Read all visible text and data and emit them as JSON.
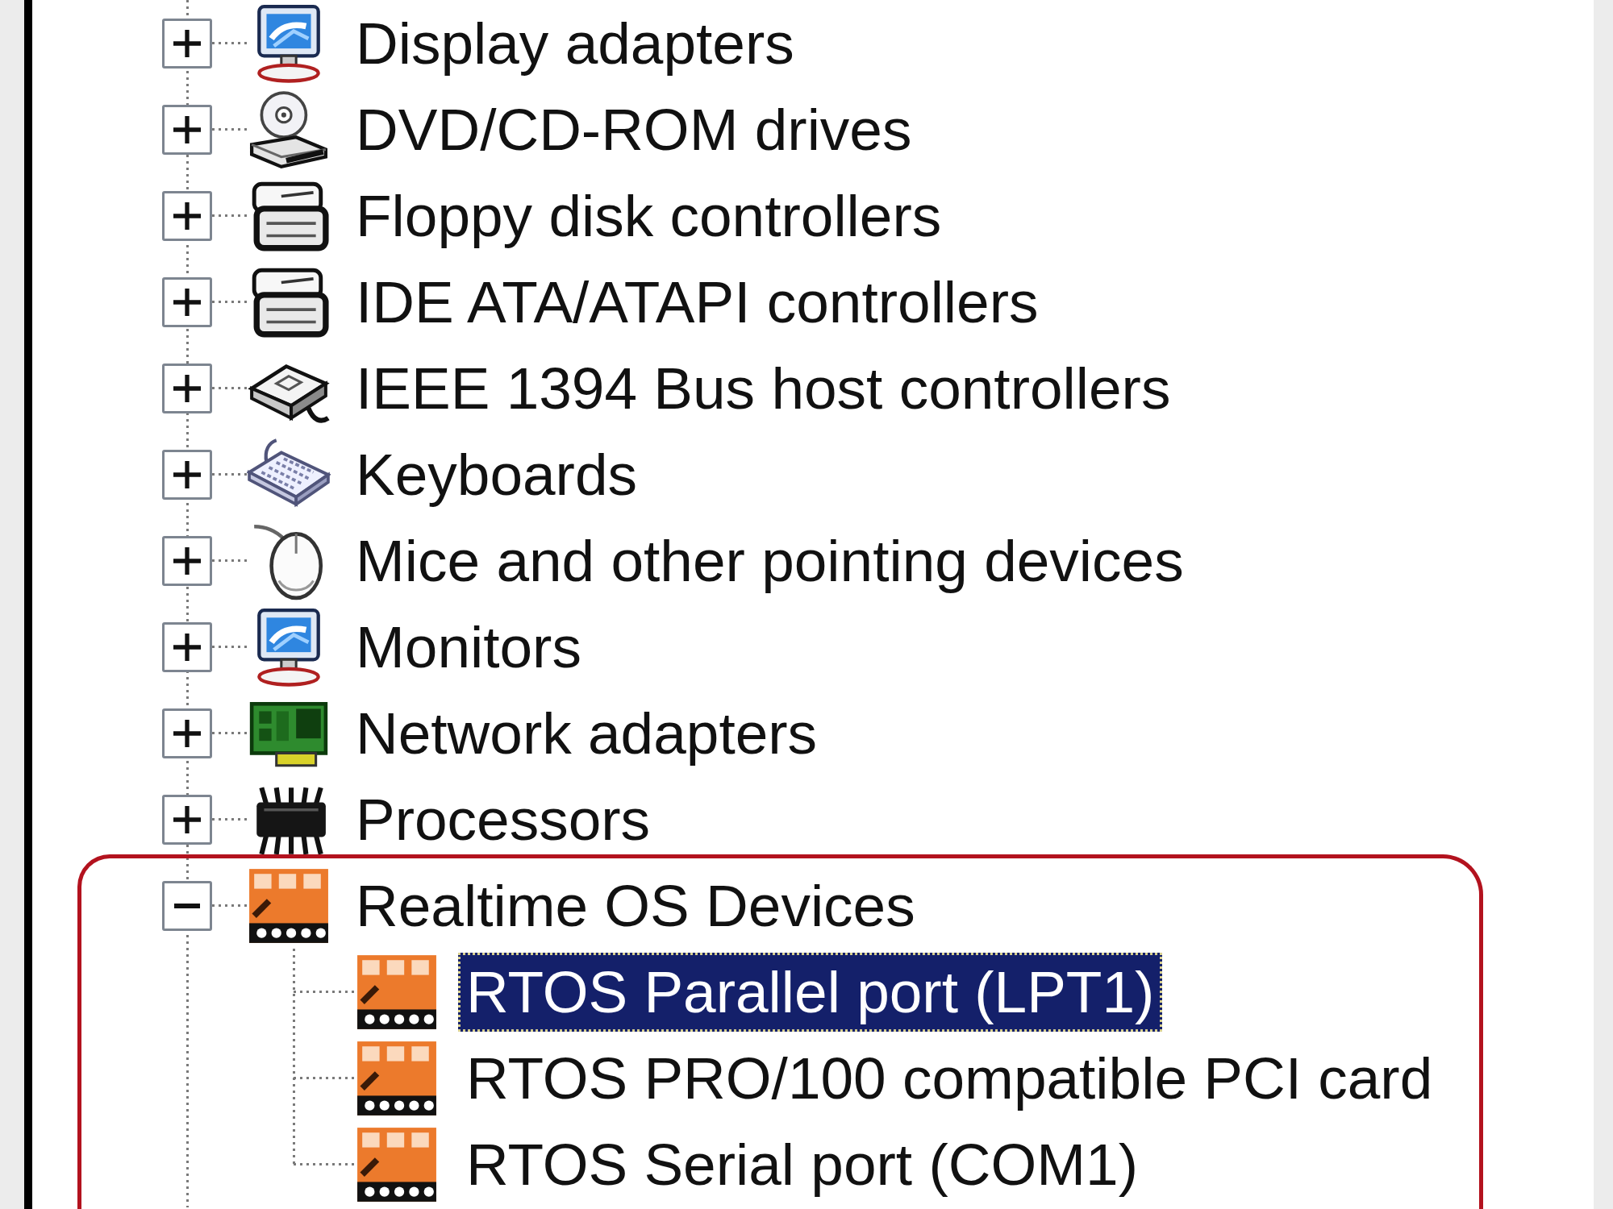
{
  "device_tree": {
    "items": [
      {
        "label": "Display adapters",
        "expanded": false,
        "selected": false
      },
      {
        "label": "DVD/CD-ROM drives",
        "expanded": false,
        "selected": false
      },
      {
        "label": "Floppy disk controllers",
        "expanded": false,
        "selected": false
      },
      {
        "label": "IDE ATA/ATAPI controllers",
        "expanded": false,
        "selected": false
      },
      {
        "label": "IEEE 1394 Bus host controllers",
        "expanded": false,
        "selected": false
      },
      {
        "label": "Keyboards",
        "expanded": false,
        "selected": false
      },
      {
        "label": "Mice and other pointing devices",
        "expanded": false,
        "selected": false
      },
      {
        "label": "Monitors",
        "expanded": false,
        "selected": false
      },
      {
        "label": "Network adapters",
        "expanded": false,
        "selected": false
      },
      {
        "label": "Processors",
        "expanded": false,
        "selected": false
      },
      {
        "label": "Realtime OS Devices",
        "expanded": true,
        "selected": false,
        "children": [
          {
            "label": "RTOS Parallel port (LPT1)",
            "selected": true
          },
          {
            "label": "RTOS PRO/100 compatible PCI card",
            "selected": false
          },
          {
            "label": "RTOS Serial port (COM1)",
            "selected": false
          }
        ]
      }
    ]
  }
}
